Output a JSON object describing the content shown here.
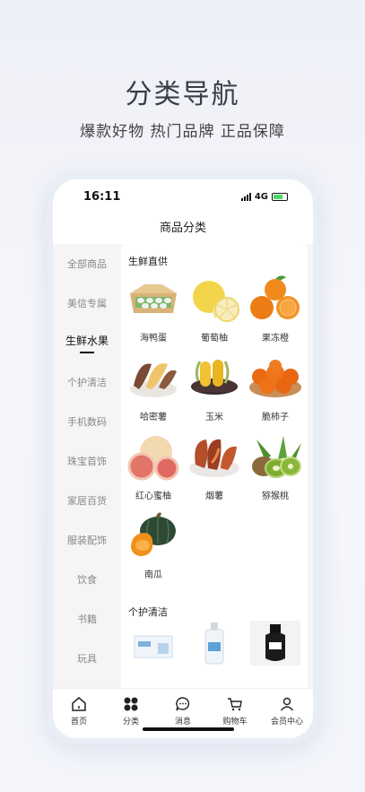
{
  "promo": {
    "title": "分类导航",
    "subtitle": "爆款好物 热门品牌 正品保障"
  },
  "status": {
    "time": "16:11",
    "network": "4G"
  },
  "header": {
    "title": "商品分类"
  },
  "sidebar": {
    "items": [
      {
        "label": "全部商品",
        "active": false
      },
      {
        "label": "美信专属",
        "active": false
      },
      {
        "label": "生鲜水果",
        "active": true
      },
      {
        "label": "个护清洁",
        "active": false
      },
      {
        "label": "手机数码",
        "active": false
      },
      {
        "label": "珠宝首饰",
        "active": false
      },
      {
        "label": "家居百货",
        "active": false
      },
      {
        "label": "服装配饰",
        "active": false
      },
      {
        "label": "饮食",
        "active": false
      },
      {
        "label": "书籍",
        "active": false
      },
      {
        "label": "玩具",
        "active": false
      }
    ]
  },
  "sections": [
    {
      "title": "生鲜直供",
      "products": [
        {
          "name": "海鸭蛋",
          "icon": "duck-egg-box"
        },
        {
          "name": "葡萄柚",
          "icon": "grapefruit"
        },
        {
          "name": "果冻橙",
          "icon": "orange"
        },
        {
          "name": "哈密薯",
          "icon": "sweet-potato"
        },
        {
          "name": "玉米",
          "icon": "corn"
        },
        {
          "name": "脆柿子",
          "icon": "persimmon"
        },
        {
          "name": "红心蜜柚",
          "icon": "red-pomelo"
        },
        {
          "name": "烟薯",
          "icon": "roasted-potato"
        },
        {
          "name": "猕猴桃",
          "icon": "kiwi"
        },
        {
          "name": "南瓜",
          "icon": "pumpkin"
        }
      ]
    },
    {
      "title": "个护清洁",
      "products": [
        {
          "name": "",
          "icon": "tissue-box"
        },
        {
          "name": "",
          "icon": "hand-sanitizer"
        },
        {
          "name": "",
          "icon": "toner-bottle"
        }
      ]
    }
  ],
  "tabbar": [
    {
      "label": "首页",
      "icon": "home-icon"
    },
    {
      "label": "分类",
      "icon": "category-icon"
    },
    {
      "label": "消息",
      "icon": "message-icon"
    },
    {
      "label": "购物车",
      "icon": "cart-icon"
    },
    {
      "label": "会员中心",
      "icon": "user-icon"
    }
  ]
}
